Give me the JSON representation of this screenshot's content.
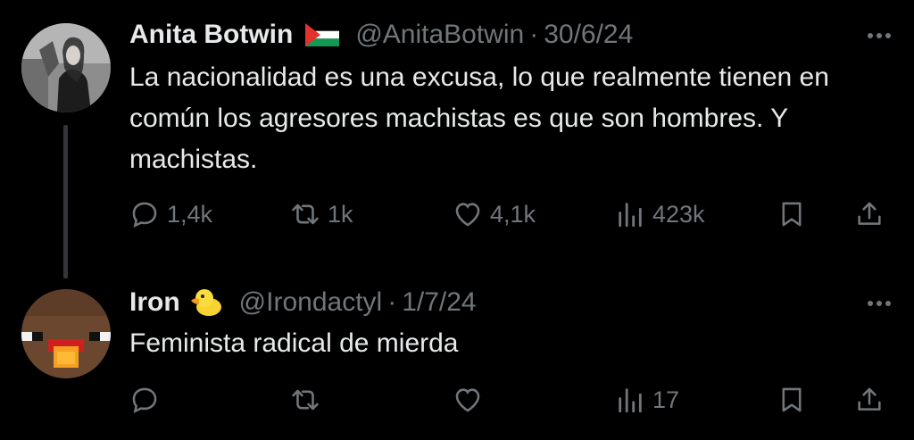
{
  "tweets": [
    {
      "name": "Anita Botwin",
      "badge": "palestine-flag",
      "handle": "@AnitaBotwin",
      "separator": "·",
      "date": "30/6/24",
      "text": "La nacionalidad es una excusa, lo que realmente tienen en común los agresores machistas es que son hombres. Y machistas.",
      "replies": "1,4k",
      "retweets": "1k",
      "likes": "4,1k",
      "views": "423k"
    },
    {
      "name": "Iron",
      "badge": "duck-emoji",
      "handle": "@Irondactyl",
      "separator": "·",
      "date": "1/7/24",
      "text": "Feminista radical de mierda",
      "replies": "",
      "retweets": "",
      "likes": "",
      "views": "17"
    }
  ],
  "colors": {
    "background": "#000000",
    "text_primary": "#e7e9ea",
    "text_secondary": "#71767b",
    "thread_line": "#333639"
  }
}
